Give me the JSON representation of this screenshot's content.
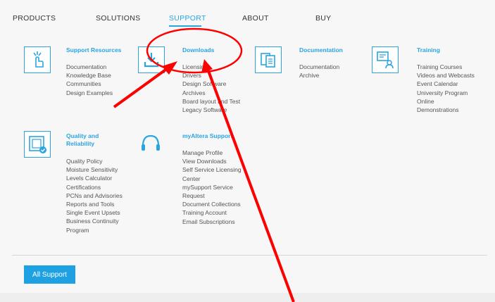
{
  "nav": {
    "items": [
      {
        "label": "PRODUCTS"
      },
      {
        "label": "SOLUTIONS"
      },
      {
        "label": "SUPPORT",
        "active": true
      },
      {
        "label": "ABOUT"
      },
      {
        "label": "BUY"
      }
    ]
  },
  "sections": {
    "support_resources": {
      "title": "Support Resources",
      "links": [
        "Documentation",
        "Knowledge Base",
        "Communities",
        "Design Examples"
      ]
    },
    "downloads": {
      "title": "Downloads",
      "links": [
        "Licensing",
        "Drivers",
        "Design Software",
        "Archives",
        "Board layout and Test",
        "Legacy Software"
      ]
    },
    "documentation": {
      "title": "Documentation",
      "links": [
        "Documentation",
        "Archive"
      ]
    },
    "training": {
      "title": "Training",
      "links": [
        "Training Courses",
        "Videos and Webcasts",
        "Event Calendar",
        "University Program",
        "Online",
        "Demonstrations"
      ]
    },
    "quality": {
      "title_line1": "Quality and",
      "title_line2": "Reliability",
      "links": [
        "Quality Policy",
        "Moisture Sensitivity",
        "Levels Calculator",
        "Certifications",
        "PCNs and Advisories",
        "Reports and Tools",
        "Single Event Upsets",
        "Business Continuity",
        "Program"
      ]
    },
    "myaltera": {
      "title": "myAltera Support",
      "links": [
        "Manage Profile",
        "View Downloads",
        "Self Service Licensing",
        "Center",
        "mySupport Service",
        "Request",
        "Document Collections",
        "Training Account",
        "Email Subscriptions"
      ]
    }
  },
  "all_support_label": "All Support",
  "colors": {
    "accent": "#2aa5e0",
    "annotation": "#ff0000"
  },
  "icons": {
    "support_resources": "hand-touch-icon",
    "downloads": "download-icon",
    "documentation": "documents-icon",
    "training": "presentation-icon",
    "quality": "quality-check-icon",
    "myaltera": "headset-icon"
  }
}
